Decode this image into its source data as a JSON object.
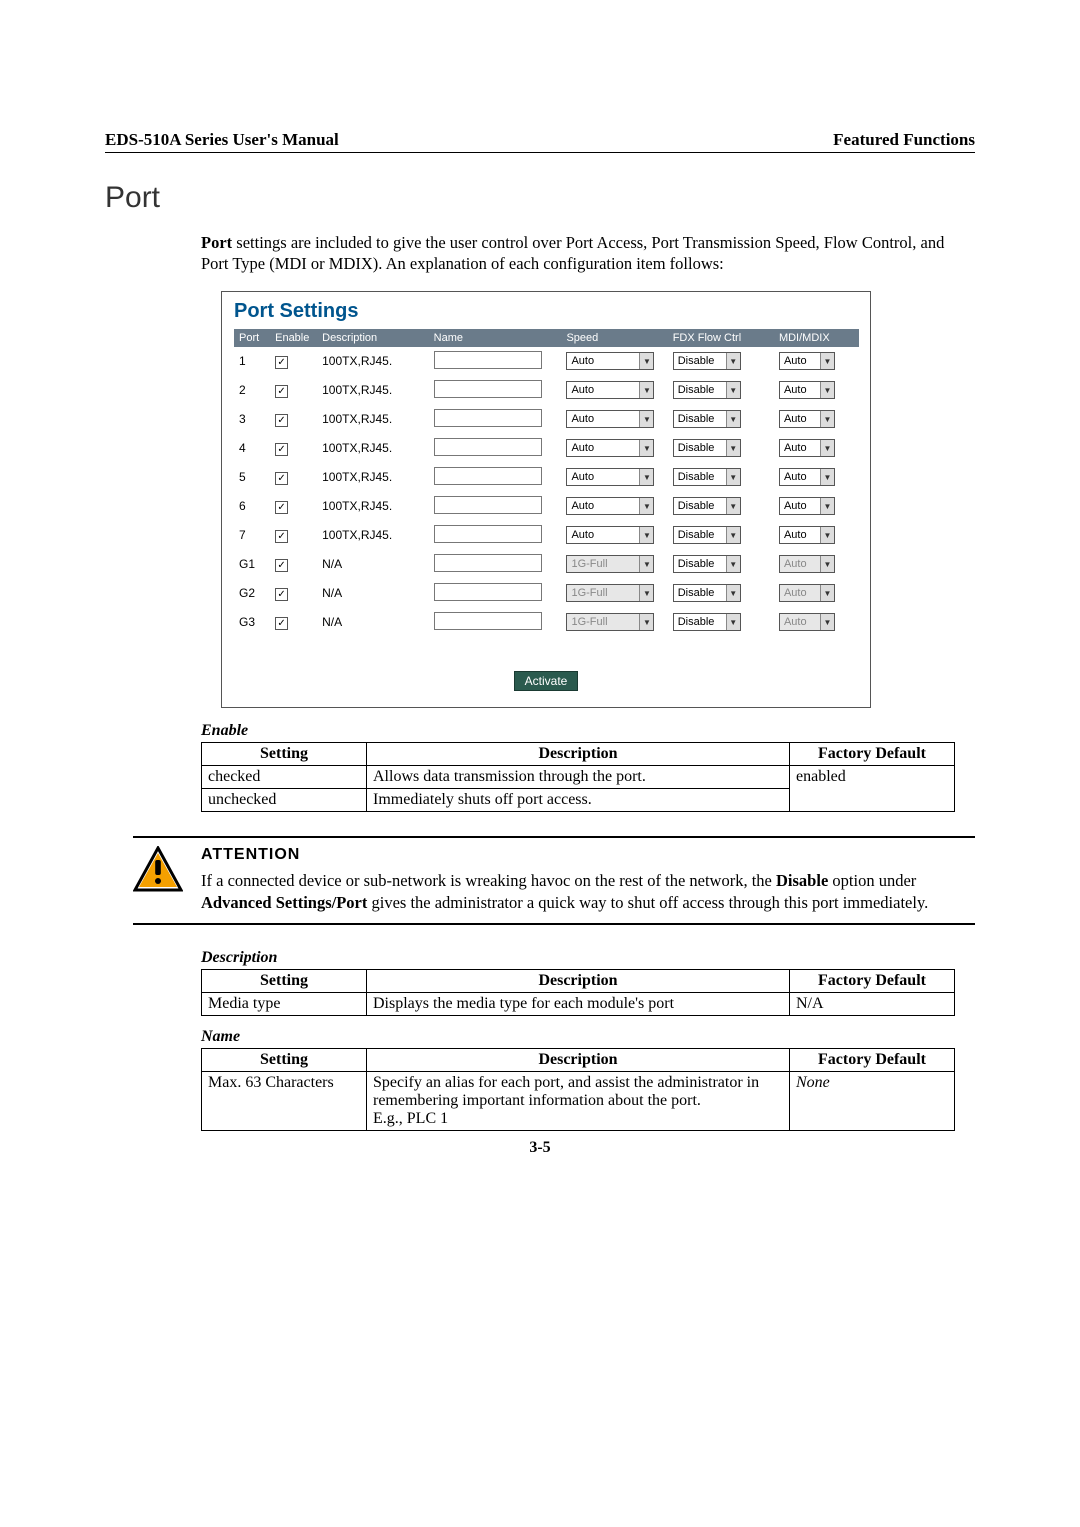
{
  "header": {
    "left": "EDS-510A Series User's Manual",
    "right": "Featured Functions"
  },
  "section_title": "Port",
  "intro_prefix": "Port",
  "intro_rest": " settings are included to give the user control over Port Access, Port Transmission Speed, Flow Control, and Port Type (MDI or MDIX). An explanation of each configuration item follows:",
  "port_settings": {
    "title": "Port Settings",
    "cols": {
      "port": "Port",
      "enable": "Enable",
      "description": "Description",
      "name": "Name",
      "speed": "Speed",
      "fdx": "FDX Flow Ctrl",
      "mdi": "MDI/MDIX"
    },
    "rows": [
      {
        "port": "1",
        "enable": true,
        "description": "100TX,RJ45.",
        "name": "",
        "speed": "Auto",
        "speed_disabled": false,
        "fdx": "Disable",
        "mdi": "Auto",
        "mdi_disabled": false
      },
      {
        "port": "2",
        "enable": true,
        "description": "100TX,RJ45.",
        "name": "",
        "speed": "Auto",
        "speed_disabled": false,
        "fdx": "Disable",
        "mdi": "Auto",
        "mdi_disabled": false
      },
      {
        "port": "3",
        "enable": true,
        "description": "100TX,RJ45.",
        "name": "",
        "speed": "Auto",
        "speed_disabled": false,
        "fdx": "Disable",
        "mdi": "Auto",
        "mdi_disabled": false
      },
      {
        "port": "4",
        "enable": true,
        "description": "100TX,RJ45.",
        "name": "",
        "speed": "Auto",
        "speed_disabled": false,
        "fdx": "Disable",
        "mdi": "Auto",
        "mdi_disabled": false
      },
      {
        "port": "5",
        "enable": true,
        "description": "100TX,RJ45.",
        "name": "",
        "speed": "Auto",
        "speed_disabled": false,
        "fdx": "Disable",
        "mdi": "Auto",
        "mdi_disabled": false
      },
      {
        "port": "6",
        "enable": true,
        "description": "100TX,RJ45.",
        "name": "",
        "speed": "Auto",
        "speed_disabled": false,
        "fdx": "Disable",
        "mdi": "Auto",
        "mdi_disabled": false
      },
      {
        "port": "7",
        "enable": true,
        "description": "100TX,RJ45.",
        "name": "",
        "speed": "Auto",
        "speed_disabled": false,
        "fdx": "Disable",
        "mdi": "Auto",
        "mdi_disabled": false
      },
      {
        "port": "G1",
        "enable": true,
        "description": "N/A",
        "name": "",
        "speed": "1G-Full",
        "speed_disabled": true,
        "fdx": "Disable",
        "mdi": "Auto",
        "mdi_disabled": true
      },
      {
        "port": "G2",
        "enable": true,
        "description": "N/A",
        "name": "",
        "speed": "1G-Full",
        "speed_disabled": true,
        "fdx": "Disable",
        "mdi": "Auto",
        "mdi_disabled": true
      },
      {
        "port": "G3",
        "enable": true,
        "description": "N/A",
        "name": "",
        "speed": "1G-Full",
        "speed_disabled": true,
        "fdx": "Disable",
        "mdi": "Auto",
        "mdi_disabled": true
      }
    ],
    "button": "Activate"
  },
  "enable": {
    "heading": "Enable",
    "th": {
      "setting": "Setting",
      "description": "Description",
      "default": "Factory Default"
    },
    "rows": [
      {
        "setting": "checked",
        "description": "Allows data transmission through the port."
      },
      {
        "setting": "unchecked",
        "description": "Immediately shuts off port access."
      }
    ],
    "default": "enabled"
  },
  "attention": {
    "label": "ATTENTION",
    "parts": [
      "If a connected device or sub-network is wreaking havoc on the rest of the network, the ",
      "Disable",
      " option under ",
      "Advanced Settings/Port",
      " gives the administrator a quick way to shut off access through this port immediately."
    ]
  },
  "description_field": {
    "heading": "Description",
    "th": {
      "setting": "Setting",
      "description": "Description",
      "default": "Factory Default"
    },
    "row": {
      "setting": "Media type",
      "description": "Displays the media type for each module's port",
      "default": "N/A"
    }
  },
  "name_field": {
    "heading": "Name",
    "th": {
      "setting": "Setting",
      "description": "Description",
      "default": "Factory Default"
    },
    "row": {
      "setting": "Max. 63 Characters",
      "description": "Specify an alias for each port, and assist the administrator in remembering important information about the port.\nE.g., PLC 1",
      "default_italic": "None"
    }
  },
  "page_number": "3-5"
}
